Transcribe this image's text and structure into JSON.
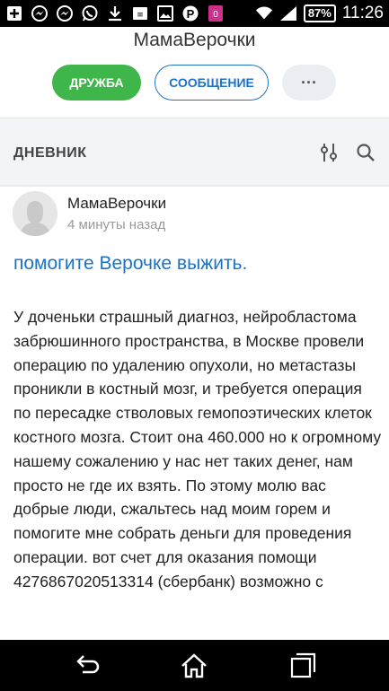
{
  "status_bar": {
    "icons": [
      "plus-box-icon",
      "messenger-icon",
      "messenger-icon",
      "whatsapp-icon",
      "download-icon",
      "sim-icon",
      "gallery-icon",
      "pinterest-icon",
      "app-badge-icon",
      "wifi-icon",
      "signal-icon"
    ],
    "battery": "87%",
    "time": "11:26"
  },
  "profile": {
    "name": "МамаВерочки",
    "friend_label": "ДРУЖБА",
    "message_label": "СООБЩЕНИЕ",
    "more_label": "···"
  },
  "section": {
    "title": "ДНЕВНИК"
  },
  "post": {
    "author": "МамаВерочки",
    "time": "4 минуты назад",
    "title": "помогите Верочке выжить.",
    "body": "У доченьки страшный диагноз, нейробластома забрюшинного пространства, в Москве провели операцию по удалению опухоли, но метастазы проникли в костный мозг, и требуется операция по пересадке стволовых гемопоэтических клеток костного мозга. Стоит она 460.000 но к огромному нашему сожалению у нас нет таких денег, нам просто не где их взять. По этому молю вас добрые люди, сжальтесь над моим горем и помогите мне собрать деньги для проведения операции. вот счет для оказания помощи 4276867020513314 (сбербанк) возможно с"
  },
  "colors": {
    "accent_green": "#3fb64a",
    "accent_blue": "#1e73c8",
    "title_blue": "#1a73c7"
  }
}
